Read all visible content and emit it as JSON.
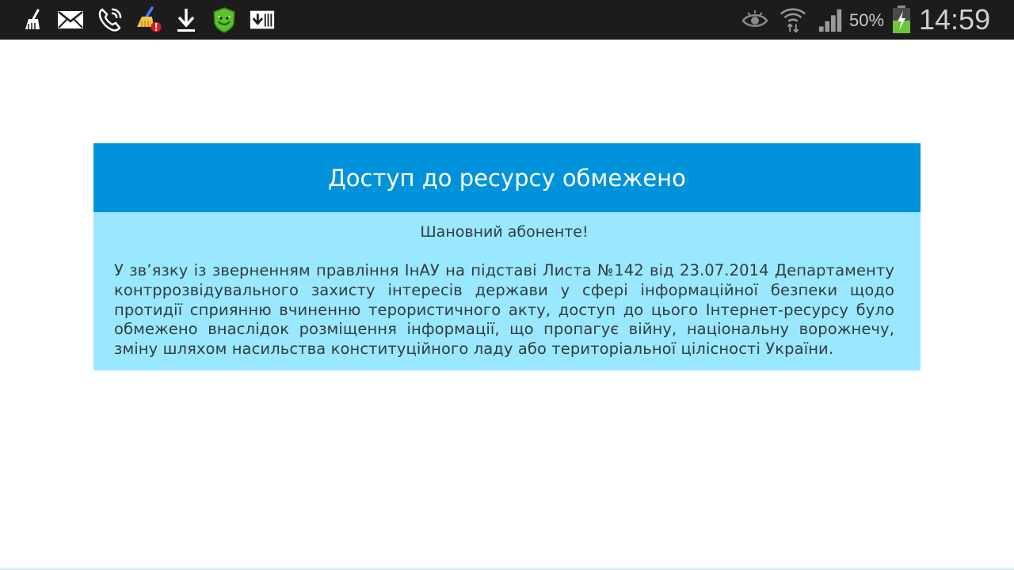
{
  "status_bar": {
    "left_icons": [
      "broom-icon",
      "mail-icon",
      "missed-call-icon",
      "cleaner-alert-icon",
      "download-icon",
      "security-app-icon",
      "download-folder-icon"
    ],
    "right_icons": [
      "eye-icon",
      "wifi-icon",
      "signal-icon",
      "battery-charging-icon"
    ],
    "battery_percent": "50%",
    "time": "14:59"
  },
  "notice": {
    "title": "Доступ до ресурсу обмежено",
    "greeting": "Шановний абоненте!",
    "message": "У зв’язку із зверненням правління ІнАУ на підставі Листа №142 від 23.07.2014 Департаменту контррозвідувального захисту інтересів держави у сфері інформаційної безпеки щодо протидії сприянню вчиненню терористичного акту, доступ до цього Інтернет-ресурсу було обмежено внаслідок розміщення інформації, що пропагує війну, національну ворожнечу, зміну шляхом насильства конституційного ладу або територіальної цілісності України."
  },
  "colors": {
    "status_bar_bg": "#1c1c1c",
    "header_bg": "#0093dc",
    "body_bg": "#9ae8ff",
    "text": "#333c40"
  }
}
